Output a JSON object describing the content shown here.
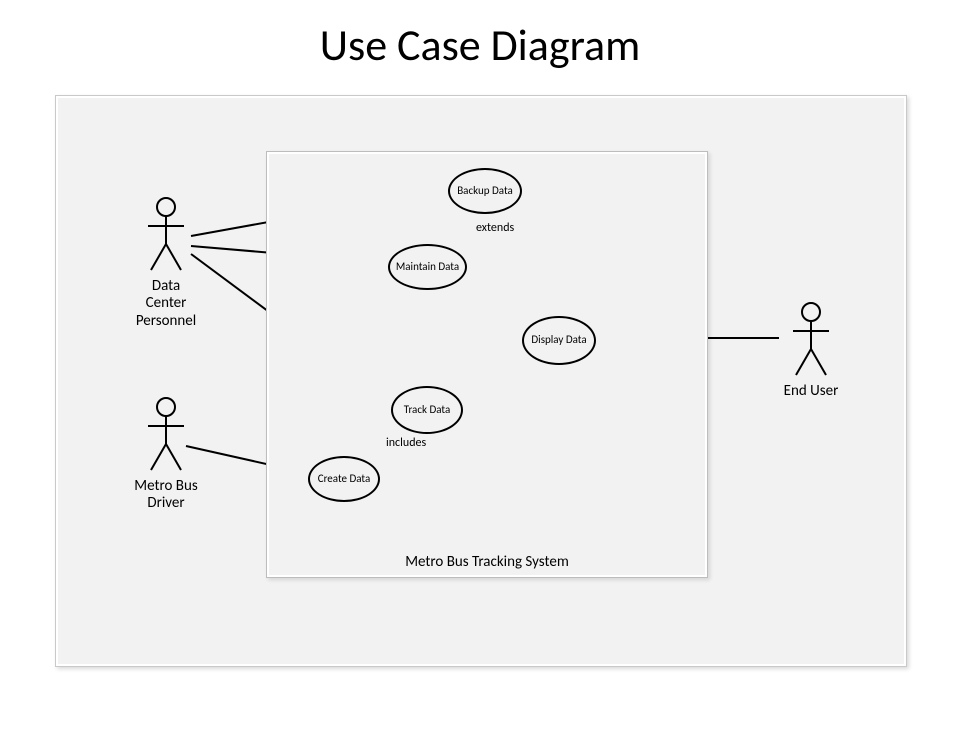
{
  "title": "Use Case Diagram",
  "system_name": "Metro Bus Tracking System",
  "actors": {
    "data_center": {
      "label": "Data Center Personnel"
    },
    "metro_driver": {
      "label": "Metro Bus Driver"
    },
    "end_user": {
      "label": "End User"
    }
  },
  "use_cases": {
    "backup": {
      "label": "Backup Data"
    },
    "maintain": {
      "label": "Maintain Data"
    },
    "display": {
      "label": "Display Data"
    },
    "track": {
      "label": "Track Data"
    },
    "create": {
      "label": "Create Data"
    }
  },
  "relationships": {
    "extends": "extends",
    "includes": "includes"
  }
}
